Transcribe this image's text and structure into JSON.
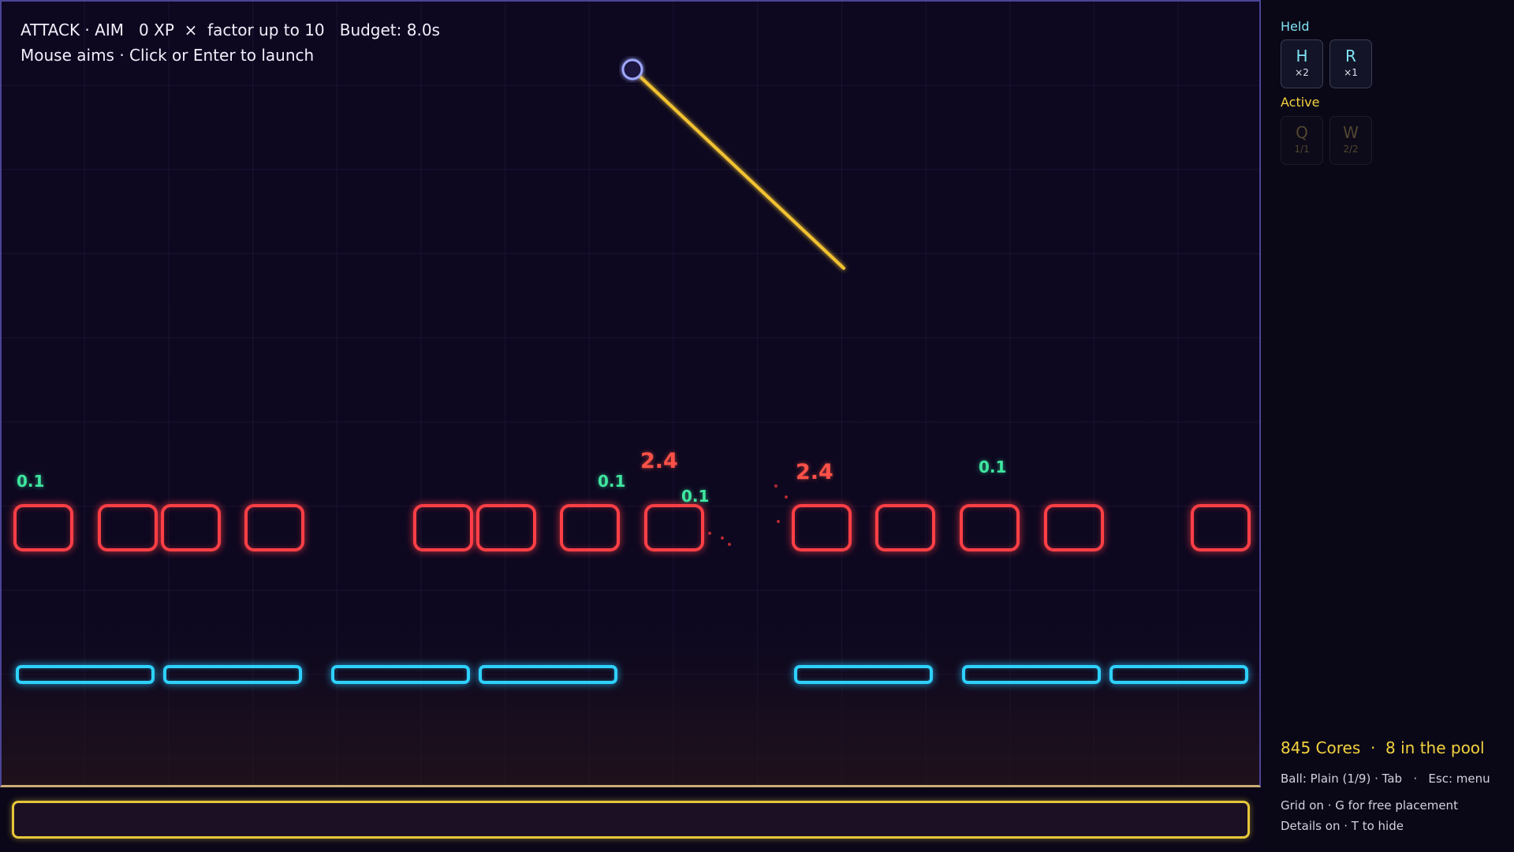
{
  "hud": {
    "line1": "ATTACK · AIM   0 XP  ×  factor up to 10   Budget: 8.0s",
    "line2": "Mouse aims · Click or Enter to launch"
  },
  "colors": {
    "brick": "#ff3f46",
    "paddle": "#2ed1ff",
    "aim_line": "#f2c232",
    "ball": "#9fa8ff",
    "launch_bar": "#e6c63b",
    "small_factor": "#3fe6a0",
    "big_factor": "#ff5148"
  },
  "factor_labels": [
    {
      "text": "0.1",
      "kind": "small"
    },
    {
      "text": "0.1",
      "kind": "small"
    },
    {
      "text": "2.4",
      "kind": "big"
    },
    {
      "text": "0.1",
      "kind": "small"
    },
    {
      "text": "2.4",
      "kind": "big"
    },
    {
      "text": "0.1",
      "kind": "small"
    }
  ],
  "sidebar": {
    "held_label": "Held",
    "held": [
      {
        "key": "H",
        "count": "×2"
      },
      {
        "key": "R",
        "count": "×1"
      }
    ],
    "active_label": "Active",
    "active": [
      {
        "key": "Q",
        "count": "1/1"
      },
      {
        "key": "W",
        "count": "2/2"
      }
    ],
    "status": "845 Cores  ·  8 in the pool",
    "ball_hint": "Ball: Plain (1/9) · Tab   ·   Esc: menu",
    "grid_hint": "Grid on · G for free placement",
    "details_hint": "Details on · T to hide"
  }
}
